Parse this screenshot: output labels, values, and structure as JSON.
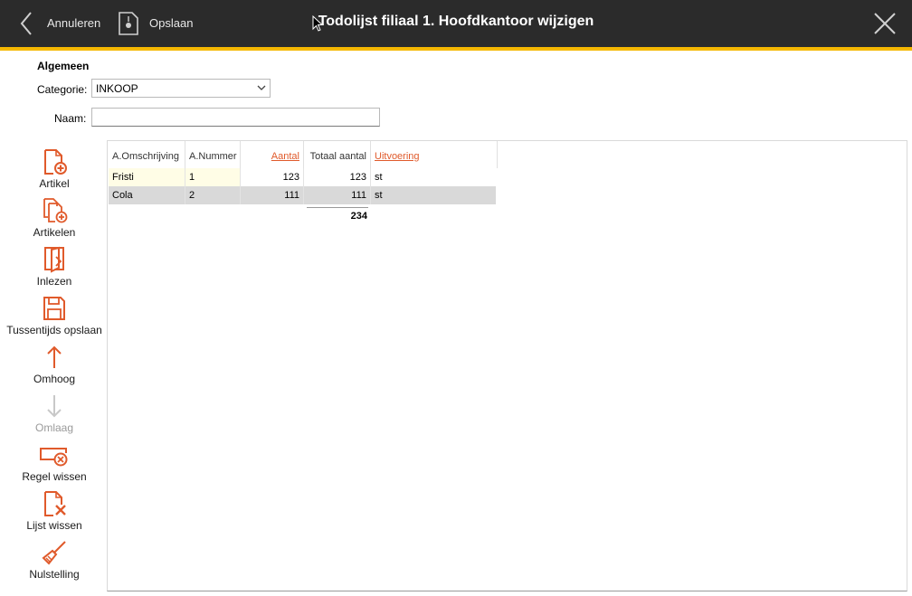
{
  "titlebar": {
    "cancel_label": "Annuleren",
    "save_label": "Opslaan",
    "title": "Todolijst filiaal 1. Hoofdkantoor wijzigen"
  },
  "form": {
    "section": "Algemeen",
    "categorie_label": "Categorie:",
    "categorie_value": "INKOOP",
    "naam_label": "Naam:",
    "naam_value": ""
  },
  "toolbar": [
    {
      "label": "Artikel",
      "icon": "document-add-icon",
      "enabled": true
    },
    {
      "label": "Artikelen",
      "icon": "documents-add-icon",
      "enabled": true
    },
    {
      "label": "Inlezen",
      "icon": "import-icon",
      "enabled": true
    },
    {
      "label": "Tussentijds opslaan",
      "icon": "save-icon",
      "enabled": true
    },
    {
      "label": "Omhoog",
      "icon": "arrow-up-icon",
      "enabled": true
    },
    {
      "label": "Omlaag",
      "icon": "arrow-down-icon",
      "enabled": false
    },
    {
      "label": "Regel wissen",
      "icon": "delete-row-icon",
      "enabled": true
    },
    {
      "label": "Lijst wissen",
      "icon": "delete-list-icon",
      "enabled": true
    },
    {
      "label": "Nulstelling",
      "icon": "broom-icon",
      "enabled": true
    }
  ],
  "table": {
    "columns": [
      "A.Omschrijving",
      "A.Nummer",
      "Aantal",
      "Totaal aantal",
      "Uitvoering"
    ],
    "rows": [
      [
        "Fristi",
        "1",
        "123",
        "123",
        "st"
      ],
      [
        "Cola",
        "2",
        "111",
        "111",
        "st"
      ]
    ],
    "total": "234"
  },
  "colors": {
    "accent": "#f5b800",
    "icon": "#e05a2b",
    "titlebar": "#2b2b2b"
  }
}
